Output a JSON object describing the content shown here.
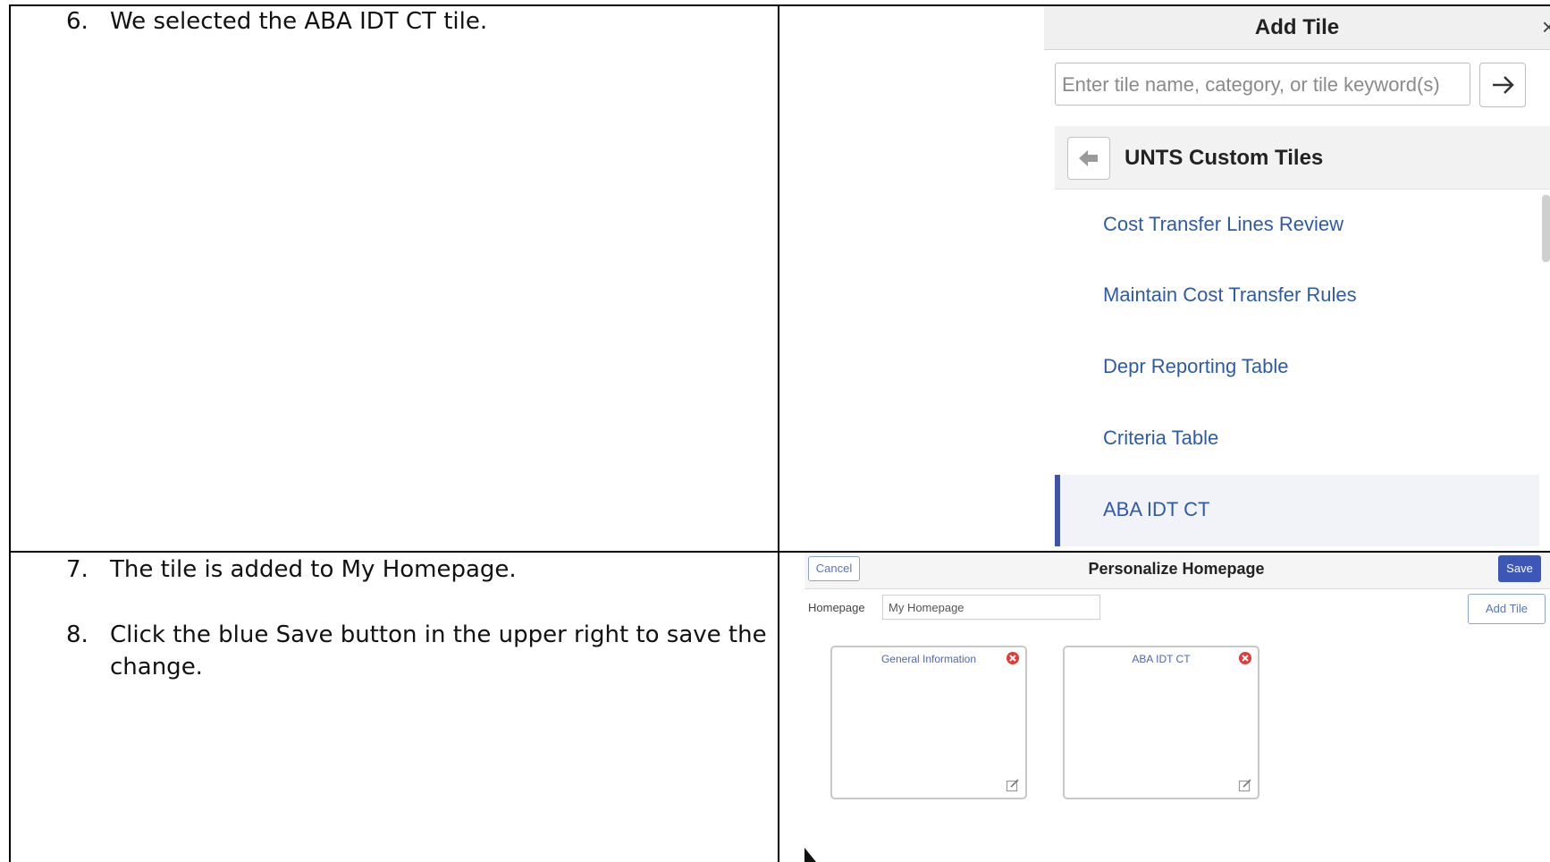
{
  "steps": [
    {
      "number": "6.",
      "text": "We selected the ABA IDT CT tile."
    },
    {
      "number": "7.",
      "text": "The tile is added to My Homepage."
    },
    {
      "number": "8.",
      "text": "Click the blue Save button in the upper right to save the",
      "text_line2": "change."
    }
  ],
  "add_tile_panel": {
    "title": "Add Tile",
    "close_glyph": "×",
    "search_placeholder": "Enter tile name, category, or tile keyword(s)",
    "category_title": "UNTS Custom Tiles",
    "items": [
      {
        "label": "Cost Transfer Lines Review",
        "selected": false
      },
      {
        "label": "Maintain Cost Transfer Rules",
        "selected": false
      },
      {
        "label": "Depr Reporting Table",
        "selected": false
      },
      {
        "label": "Criteria Table",
        "selected": false
      },
      {
        "label": "ABA IDT CT",
        "selected": true
      }
    ],
    "icons": {
      "go": "arrow-right-icon",
      "back": "arrow-left-icon",
      "close": "close-icon"
    },
    "colors": {
      "link": "#2f5aa8",
      "selected_bar": "#3d54a8"
    }
  },
  "personalize_homepage": {
    "title": "Personalize Homepage",
    "cancel_label": "Cancel",
    "save_label": "Save",
    "homepage_label": "Homepage",
    "homepage_value": "My Homepage",
    "add_tile_label": "Add Tile",
    "tiles": [
      {
        "title": "General Information"
      },
      {
        "title": "ABA IDT CT"
      }
    ],
    "icons": {
      "remove": "remove-circle-icon",
      "edit": "edit-icon"
    },
    "colors": {
      "save": "#3c57b8",
      "remove": "#e53935"
    }
  }
}
